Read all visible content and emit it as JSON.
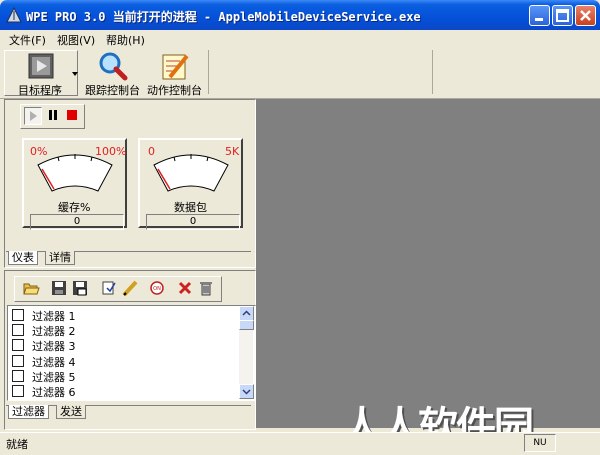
{
  "window": {
    "title": "WPE PRO 3.0 当前打开的进程 - AppleMobileDeviceService.exe"
  },
  "menu": {
    "items": [
      "文件(F)",
      "视图(V)",
      "帮助(H)"
    ]
  },
  "toolbar": {
    "target_label": "目标程序",
    "trace_label": "跟踪控制台",
    "action_label": "动作控制台"
  },
  "gauges": [
    {
      "min_label": "0%",
      "max_label": "100%",
      "title": "缓存%",
      "value": "0"
    },
    {
      "min_label": "0",
      "max_label": "5K",
      "title": "数据包",
      "value": "0"
    }
  ],
  "top_tabs": [
    "仪表",
    "详情"
  ],
  "filters": {
    "items": [
      "过滤器 1",
      "过滤器 2",
      "过滤器 3",
      "过滤器 4",
      "过滤器 5",
      "过滤器 6"
    ]
  },
  "bottom_tabs": [
    "过滤器",
    "发送"
  ],
  "status": {
    "text": "就绪",
    "nu": "NU"
  },
  "watermark": {
    "text": "人人软件园"
  },
  "colors": {
    "title_blue": "#0550d8",
    "gauge_red": "#e02020",
    "stop_red": "#e00000",
    "pane_gray": "#808080"
  }
}
